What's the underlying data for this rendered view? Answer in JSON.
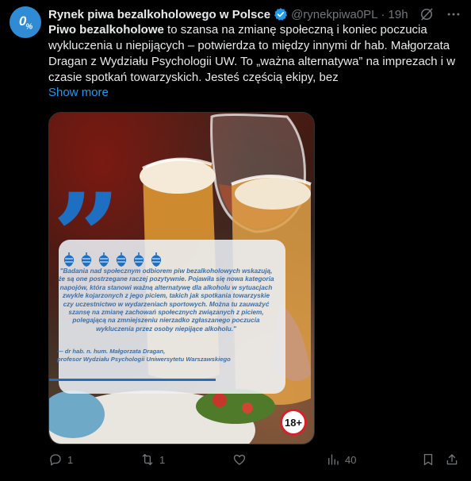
{
  "tweet": {
    "author_name": "Rynek piwa bezalkoholowego w Polsce",
    "handle": "@rynekpiwa0PL",
    "dot": "·",
    "time": "19h",
    "avatar_text": "0",
    "avatar_sub": "%",
    "body_bold": "Piwo bezalkoholowe",
    "body_rest": " to szansa na zmianę społeczną i koniec poczucia wykluczenia u niepijących – potwierdza to między innymi dr hab. Małgorzata Dragan z Wydziału Psychologii UW. To „ważna alternatywa” na imprezach i w czasie spotkań towarzyskich. Jesteś częścią ekipy, bez",
    "show_more": "Show more"
  },
  "media": {
    "quote_text": "\"Badania nad społecznym odbiorem piw bezalkoholowych wskazują, że są one postrzegane raczej pozytywnie. Pojawiła się nowa kategoria napojów, która stanowi ważną alternatywę dla alkoholu w sytuacjach zwykle kojarzonych z jego piciem, takich jak spotkania towarzyskie czy uczestnictwo w wydarzeniach sportowych. Można tu zauważyć szansę na zmianę zachowań społecznych związanych z piciem, polegającą na zmniejszeniu nierzadko zgłaszanego poczucia wykluczenia przez osoby niepijące alkoholu.\"",
    "author_line1": "— dr hab. n. hum. Małgorzata Dragan,",
    "author_line2": "profesor Wydziału Psychologii Uniwersytetu Warszawskiego",
    "age_badge": "18+",
    "quote_color": "#1e6fc2"
  },
  "actions": {
    "replies": "1",
    "retweets": "1",
    "likes": "",
    "views": "40"
  },
  "colors": {
    "accent": "#1d9bf0",
    "muted": "#71767b",
    "text": "#e7e9ea",
    "background": "#000000"
  }
}
